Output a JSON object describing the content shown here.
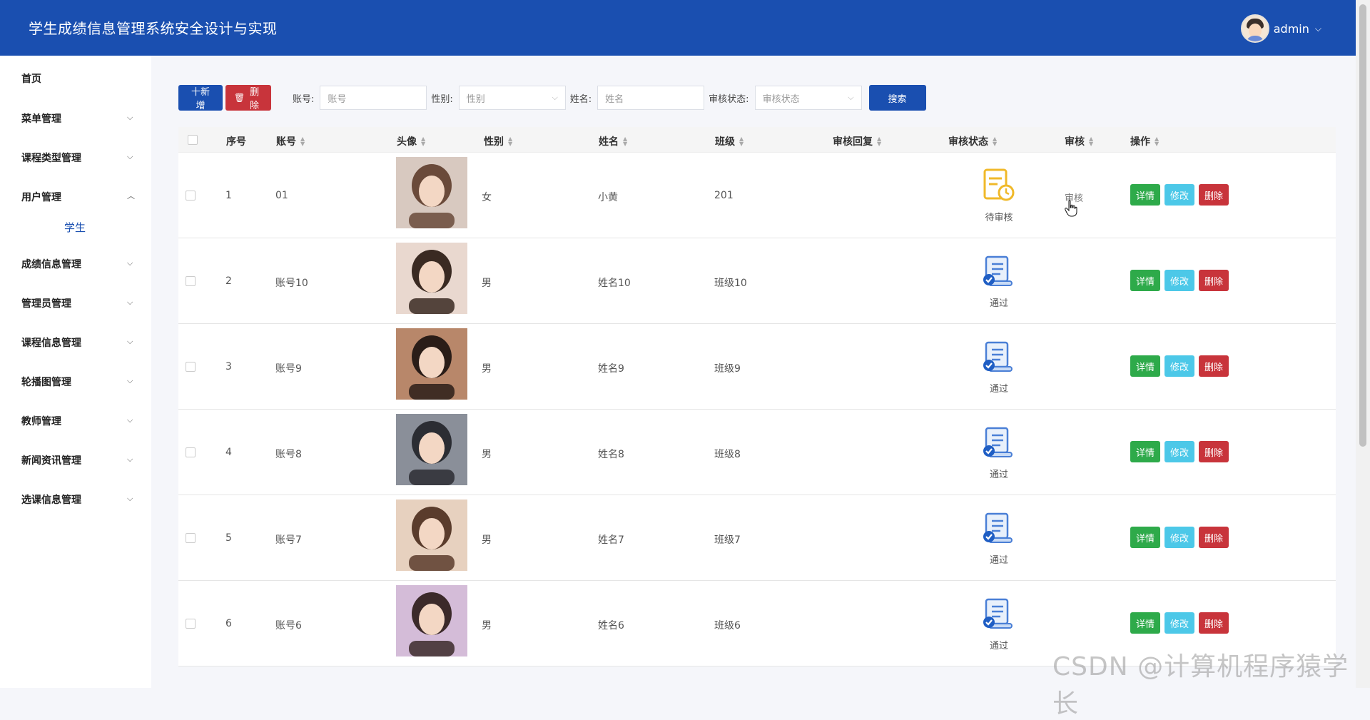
{
  "header": {
    "title": "学生成绩信息管理系统安全设计与实现",
    "user": "admin"
  },
  "sidebar": {
    "home": "首页",
    "items": [
      {
        "label": "菜单管理"
      },
      {
        "label": "课程类型管理"
      },
      {
        "label": "用户管理",
        "sub": "学生"
      },
      {
        "label": "成绩信息管理"
      },
      {
        "label": "管理员管理"
      },
      {
        "label": "课程信息管理"
      },
      {
        "label": "轮播图管理"
      },
      {
        "label": "教师管理"
      },
      {
        "label": "新闻资讯管理"
      },
      {
        "label": "选课信息管理"
      }
    ]
  },
  "toolbar": {
    "add": "十新增",
    "delete": "删除",
    "account_label": "账号:",
    "account_placeholder": "账号",
    "gender_label": "性别:",
    "gender_placeholder": "性别",
    "name_label": "姓名:",
    "name_placeholder": "姓名",
    "audit_label": "审核状态:",
    "audit_placeholder": "审核状态",
    "search": "搜索"
  },
  "table": {
    "headers": {
      "index": "序号",
      "account": "账号",
      "avatar": "头像",
      "gender": "性别",
      "name": "姓名",
      "class": "班级",
      "reply": "审核回复",
      "status": "审核状态",
      "audit": "审核",
      "ops": "操作"
    },
    "rows": [
      {
        "index": "1",
        "account": "01",
        "gender": "女",
        "name": "小黄",
        "class": "201",
        "status": "待审核",
        "audit": "审核"
      },
      {
        "index": "2",
        "account": "账号10",
        "gender": "男",
        "name": "姓名10",
        "class": "班级10",
        "status": "通过",
        "audit": ""
      },
      {
        "index": "3",
        "account": "账号9",
        "gender": "男",
        "name": "姓名9",
        "class": "班级9",
        "status": "通过",
        "audit": ""
      },
      {
        "index": "4",
        "account": "账号8",
        "gender": "男",
        "name": "姓名8",
        "class": "班级8",
        "status": "通过",
        "audit": ""
      },
      {
        "index": "5",
        "account": "账号7",
        "gender": "男",
        "name": "姓名7",
        "class": "班级7",
        "status": "通过",
        "audit": ""
      },
      {
        "index": "6",
        "account": "账号6",
        "gender": "男",
        "name": "姓名6",
        "class": "班级6",
        "status": "通过",
        "audit": ""
      }
    ],
    "op_detail": "详情",
    "op_edit": "修改",
    "op_delete": "删除"
  },
  "watermark": "CSDN @计算机程序猿学长"
}
